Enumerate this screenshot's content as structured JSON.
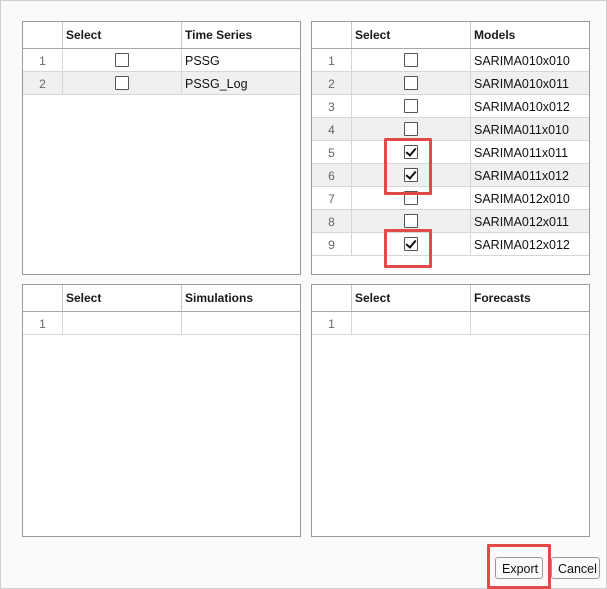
{
  "time_series": {
    "headers": {
      "select": "Select",
      "name": "Time Series"
    },
    "rows": [
      {
        "index": "1",
        "checked": false,
        "name": "PSSG"
      },
      {
        "index": "2",
        "checked": false,
        "name": "PSSG_Log"
      }
    ]
  },
  "models": {
    "headers": {
      "select": "Select",
      "name": "Models"
    },
    "rows": [
      {
        "index": "1",
        "checked": false,
        "name": "SARIMA010x010"
      },
      {
        "index": "2",
        "checked": false,
        "name": "SARIMA010x011"
      },
      {
        "index": "3",
        "checked": false,
        "name": "SARIMA010x012"
      },
      {
        "index": "4",
        "checked": false,
        "name": "SARIMA011x010"
      },
      {
        "index": "5",
        "checked": true,
        "name": "SARIMA011x011"
      },
      {
        "index": "6",
        "checked": true,
        "name": "SARIMA011x012"
      },
      {
        "index": "7",
        "checked": false,
        "name": "SARIMA012x010"
      },
      {
        "index": "8",
        "checked": false,
        "name": "SARIMA012x011"
      },
      {
        "index": "9",
        "checked": true,
        "name": "SARIMA012x012"
      }
    ]
  },
  "simulations": {
    "headers": {
      "select": "Select",
      "name": "Simulations"
    },
    "rows": [
      {
        "index": "1",
        "name": ""
      }
    ]
  },
  "forecasts": {
    "headers": {
      "select": "Select",
      "name": "Forecasts"
    },
    "rows": [
      {
        "index": "1",
        "name": ""
      }
    ]
  },
  "buttons": {
    "export": "Export",
    "cancel": "Cancel"
  },
  "colors": {
    "highlight": "#e24a4a",
    "alt_row": "#f0f0f0"
  }
}
